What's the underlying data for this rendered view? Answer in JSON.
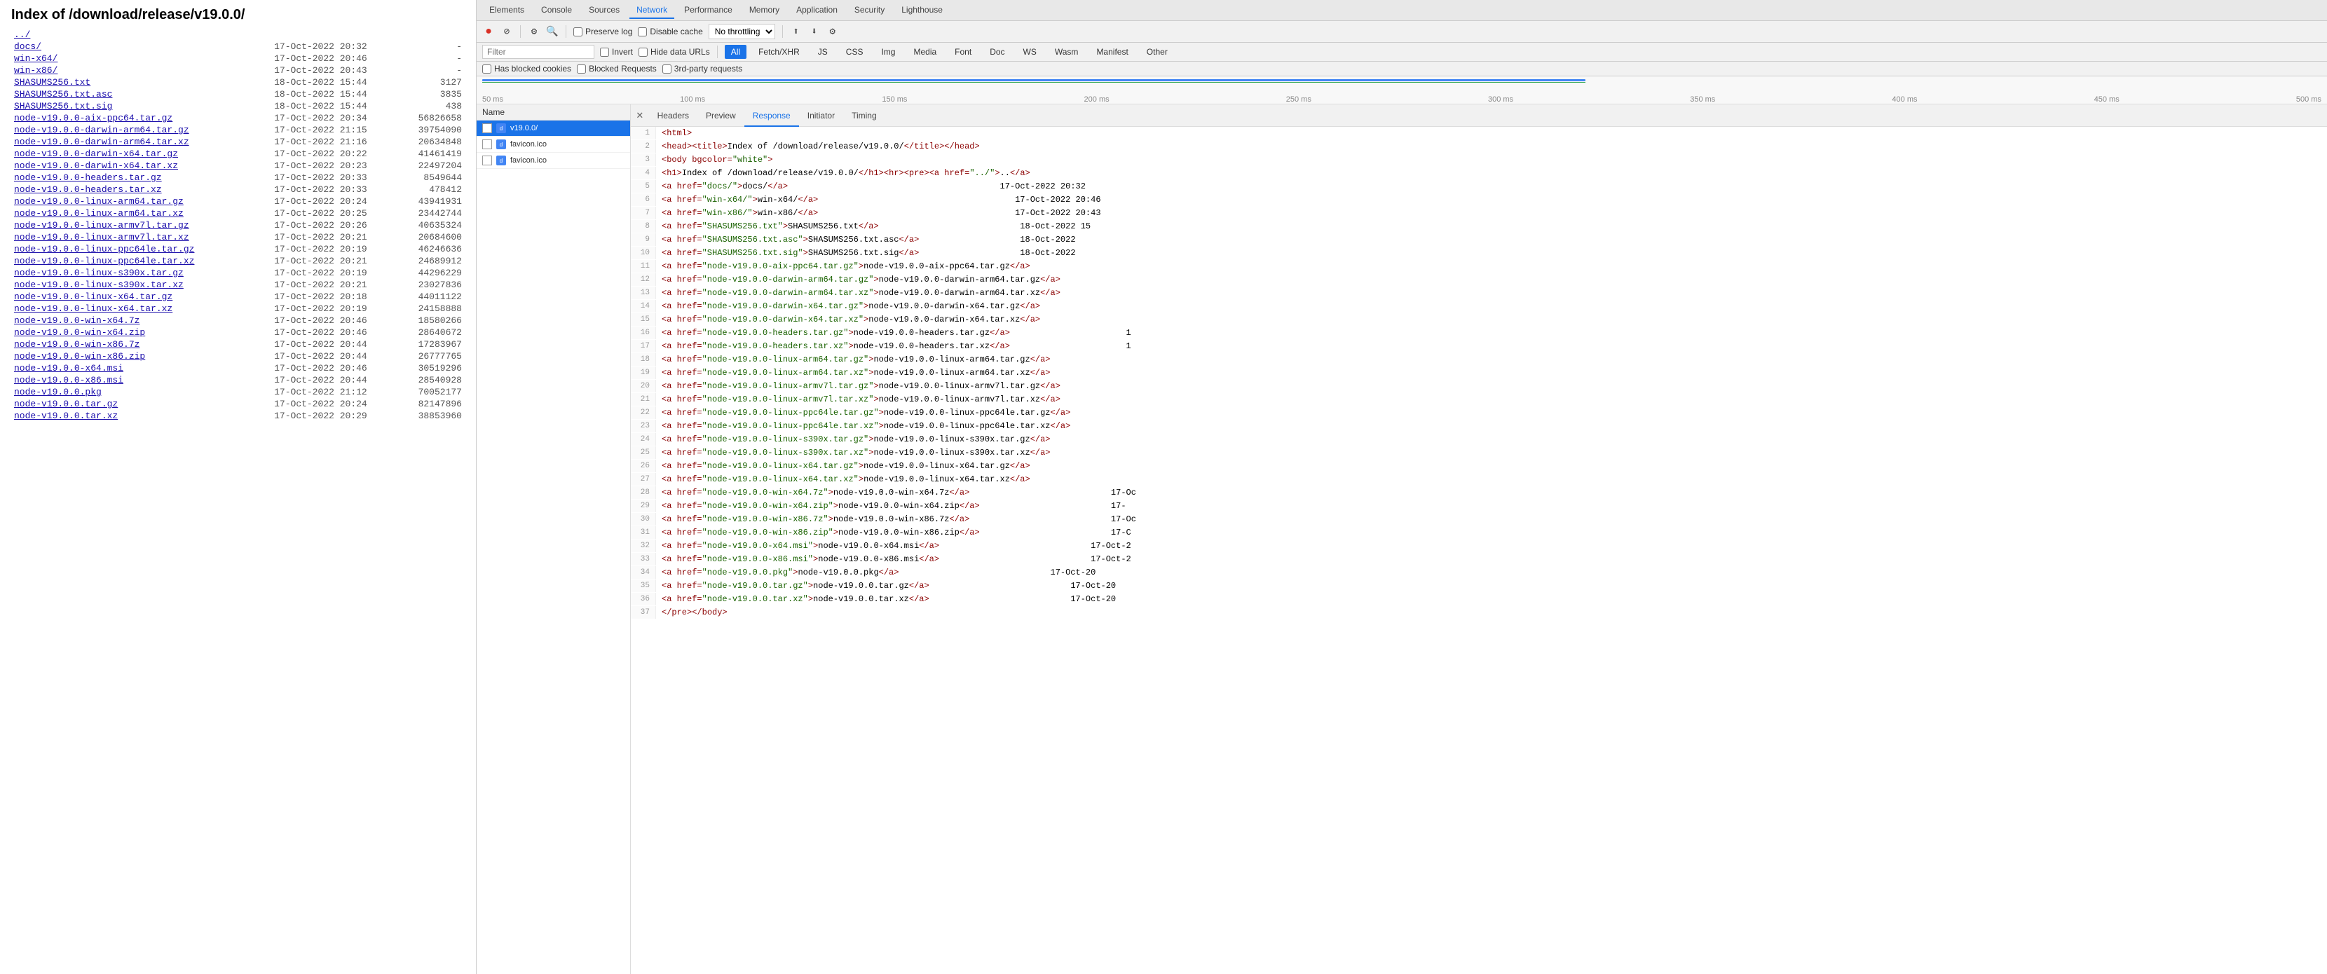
{
  "left": {
    "title": "Index of /download/release/v19.0.0/",
    "parent_link": "../",
    "entries": [
      {
        "name": "docs/",
        "href": "docs/",
        "date": "17-Oct-2022 20:32",
        "size": "-"
      },
      {
        "name": "win-x64/",
        "href": "win-x64/",
        "date": "17-Oct-2022 20:46",
        "size": "-"
      },
      {
        "name": "win-x86/",
        "href": "win-x86/",
        "date": "17-Oct-2022 20:43",
        "size": "-"
      },
      {
        "name": "SHASUMS256.txt",
        "href": "SHASUMS256.txt",
        "date": "18-Oct-2022 15:44",
        "size": "3127"
      },
      {
        "name": "SHASUMS256.txt.asc",
        "href": "SHASUMS256.txt.asc",
        "date": "18-Oct-2022 15:44",
        "size": "3835"
      },
      {
        "name": "SHASUMS256.txt.sig",
        "href": "SHASUMS256.txt.sig",
        "date": "18-Oct-2022 15:44",
        "size": "438"
      },
      {
        "name": "node-v19.0.0-aix-ppc64.tar.gz",
        "href": "node-v19.0.0-aix-ppc64.tar.gz",
        "date": "17-Oct-2022 20:34",
        "size": "56826658"
      },
      {
        "name": "node-v19.0.0-darwin-arm64.tar.gz",
        "href": "node-v19.0.0-darwin-arm64.tar.gz",
        "date": "17-Oct-2022 21:15",
        "size": "39754090"
      },
      {
        "name": "node-v19.0.0-darwin-arm64.tar.xz",
        "href": "node-v19.0.0-darwin-arm64.tar.xz",
        "date": "17-Oct-2022 21:16",
        "size": "20634848"
      },
      {
        "name": "node-v19.0.0-darwin-x64.tar.gz",
        "href": "node-v19.0.0-darwin-x64.tar.gz",
        "date": "17-Oct-2022 20:22",
        "size": "41461419"
      },
      {
        "name": "node-v19.0.0-darwin-x64.tar.xz",
        "href": "node-v19.0.0-darwin-x64.tar.xz",
        "date": "17-Oct-2022 20:23",
        "size": "22497204"
      },
      {
        "name": "node-v19.0.0-headers.tar.gz",
        "href": "node-v19.0.0-headers.tar.gz",
        "date": "17-Oct-2022 20:33",
        "size": "8549644"
      },
      {
        "name": "node-v19.0.0-headers.tar.xz",
        "href": "node-v19.0.0-headers.tar.xz",
        "date": "17-Oct-2022 20:33",
        "size": "478412"
      },
      {
        "name": "node-v19.0.0-linux-arm64.tar.gz",
        "href": "node-v19.0.0-linux-arm64.tar.gz",
        "date": "17-Oct-2022 20:24",
        "size": "43941931"
      },
      {
        "name": "node-v19.0.0-linux-arm64.tar.xz",
        "href": "node-v19.0.0-linux-arm64.tar.xz",
        "date": "17-Oct-2022 20:25",
        "size": "23442744"
      },
      {
        "name": "node-v19.0.0-linux-armv7l.tar.gz",
        "href": "node-v19.0.0-linux-armv7l.tar.gz",
        "date": "17-Oct-2022 20:26",
        "size": "40635324"
      },
      {
        "name": "node-v19.0.0-linux-armv7l.tar.xz",
        "href": "node-v19.0.0-linux-armv7l.tar.xz",
        "date": "17-Oct-2022 20:21",
        "size": "20684600"
      },
      {
        "name": "node-v19.0.0-linux-ppc64le.tar.gz",
        "href": "node-v19.0.0-linux-ppc64le.tar.gz",
        "date": "17-Oct-2022 20:19",
        "size": "46246636"
      },
      {
        "name": "node-v19.0.0-linux-ppc64le.tar.xz",
        "href": "node-v19.0.0-linux-ppc64le.tar.xz",
        "date": "17-Oct-2022 20:21",
        "size": "24689912"
      },
      {
        "name": "node-v19.0.0-linux-s390x.tar.gz",
        "href": "node-v19.0.0-linux-s390x.tar.gz",
        "date": "17-Oct-2022 20:19",
        "size": "44296229"
      },
      {
        "name": "node-v19.0.0-linux-s390x.tar.xz",
        "href": "node-v19.0.0-linux-s390x.tar.xz",
        "date": "17-Oct-2022 20:21",
        "size": "23027836"
      },
      {
        "name": "node-v19.0.0-linux-x64.tar.gz",
        "href": "node-v19.0.0-linux-x64.tar.gz",
        "date": "17-Oct-2022 20:18",
        "size": "44011122"
      },
      {
        "name": "node-v19.0.0-linux-x64.tar.xz",
        "href": "node-v19.0.0-linux-x64.tar.xz",
        "date": "17-Oct-2022 20:19",
        "size": "24158888"
      },
      {
        "name": "node-v19.0.0-win-x64.7z",
        "href": "node-v19.0.0-win-x64.7z",
        "date": "17-Oct-2022 20:46",
        "size": "18580266"
      },
      {
        "name": "node-v19.0.0-win-x64.zip",
        "href": "node-v19.0.0-win-x64.zip",
        "date": "17-Oct-2022 20:46",
        "size": "28640672"
      },
      {
        "name": "node-v19.0.0-win-x86.7z",
        "href": "node-v19.0.0-win-x86.7z",
        "date": "17-Oct-2022 20:44",
        "size": "17283967"
      },
      {
        "name": "node-v19.0.0-win-x86.zip",
        "href": "node-v19.0.0-win-x86.zip",
        "date": "17-Oct-2022 20:44",
        "size": "26777765"
      },
      {
        "name": "node-v19.0.0-x64.msi",
        "href": "node-v19.0.0-x64.msi",
        "date": "17-Oct-2022 20:46",
        "size": "30519296"
      },
      {
        "name": "node-v19.0.0-x86.msi",
        "href": "node-v19.0.0-x86.msi",
        "date": "17-Oct-2022 20:44",
        "size": "28540928"
      },
      {
        "name": "node-v19.0.0.pkg",
        "href": "node-v19.0.0.pkg",
        "date": "17-Oct-2022 21:12",
        "size": "70052177"
      },
      {
        "name": "node-v19.0.0.tar.gz",
        "href": "node-v19.0.0.tar.gz",
        "date": "17-Oct-2022 20:24",
        "size": "82147896"
      },
      {
        "name": "node-v19.0.0.tar.xz",
        "href": "node-v19.0.0.tar.xz",
        "date": "17-Oct-2022 20:29",
        "size": "38853960"
      }
    ]
  },
  "devtools": {
    "top_tabs": [
      "Elements",
      "Console",
      "Sources",
      "Network",
      "Performance",
      "Memory",
      "Application",
      "Security",
      "Lighthouse"
    ],
    "active_top_tab": "Network",
    "toolbar": {
      "record_label": "●",
      "stop_label": "⊘",
      "clear_label": "🚫",
      "filter_label": "⚙",
      "search_label": "🔍",
      "preserve_log_label": "Preserve log",
      "disable_cache_label": "Disable cache",
      "throttling_label": "No throttling",
      "upload_label": "⬆",
      "download_label": "⬇",
      "settings_label": "⚙"
    },
    "filter_row": {
      "invert_label": "Invert",
      "hide_data_urls_label": "Hide data URLs",
      "all_label": "All",
      "fetch_xhr_label": "Fetch/XHR",
      "js_label": "JS",
      "css_label": "CSS",
      "img_label": "Img",
      "media_label": "Media",
      "font_label": "Font",
      "doc_label": "Doc",
      "ws_label": "WS",
      "wasm_label": "Wasm",
      "manifest_label": "Manifest",
      "other_label": "Other",
      "has_blocked_cookies_label": "Has blocked cookies",
      "blocked_requests_label": "Blocked Requests",
      "third_party_label": "3rd-party requests"
    },
    "timeline": {
      "labels": [
        "50 ms",
        "100 ms",
        "150 ms",
        "200 ms",
        "250 ms",
        "300 ms",
        "350 ms",
        "400 ms",
        "450 ms",
        "500 ms"
      ]
    },
    "request_list": {
      "header_name": "Name",
      "requests": [
        {
          "id": "req1",
          "name": "v19.0.0/",
          "selected": true,
          "has_checkbox": true
        },
        {
          "id": "req2",
          "name": "favicon.ico",
          "selected": false,
          "has_checkbox": true
        },
        {
          "id": "req3",
          "name": "favicon.ico",
          "selected": false,
          "has_checkbox": true
        }
      ]
    },
    "details": {
      "tabs": [
        "Headers",
        "Preview",
        "Response",
        "Initiator",
        "Timing"
      ],
      "active_tab": "Response",
      "response_lines": [
        {
          "num": 1,
          "content": "<html>"
        },
        {
          "num": 2,
          "content": "<head><title>Index of /download/release/v19.0.0/</title></head>"
        },
        {
          "num": 3,
          "content": "<body bgcolor=\"white\">"
        },
        {
          "num": 4,
          "content": "<h1>Index of /download/release/v19.0.0/</h1><hr><pre><a href=\"../\">..</a>"
        },
        {
          "num": 5,
          "content": "<a href=\"docs/\">docs/</a>                                          17-Oct-2022 20:32"
        },
        {
          "num": 6,
          "content": "<a href=\"win-x64/\">win-x64/</a>                                       17-Oct-2022 20:46"
        },
        {
          "num": 7,
          "content": "<a href=\"win-x86/\">win-x86/</a>                                       17-Oct-2022 20:43"
        },
        {
          "num": 8,
          "content": "<a href=\"SHASUMS256.txt\">SHASUMS256.txt</a>                            18-Oct-2022 15"
        },
        {
          "num": 9,
          "content": "<a href=\"SHASUMS256.txt.asc\">SHASUMS256.txt.asc</a>                    18-Oct-2022"
        },
        {
          "num": 10,
          "content": "<a href=\"SHASUMS256.txt.sig\">SHASUMS256.txt.sig</a>                    18-Oct-2022"
        },
        {
          "num": 11,
          "content": "<a href=\"node-v19.0.0-aix-ppc64.tar.gz\">node-v19.0.0-aix-ppc64.tar.gz</a>"
        },
        {
          "num": 12,
          "content": "<a href=\"node-v19.0.0-darwin-arm64.tar.gz\">node-v19.0.0-darwin-arm64.tar.gz</a>"
        },
        {
          "num": 13,
          "content": "<a href=\"node-v19.0.0-darwin-arm64.tar.xz\">node-v19.0.0-darwin-arm64.tar.xz</a>"
        },
        {
          "num": 14,
          "content": "<a href=\"node-v19.0.0-darwin-x64.tar.gz\">node-v19.0.0-darwin-x64.tar.gz</a>"
        },
        {
          "num": 15,
          "content": "<a href=\"node-v19.0.0-darwin-x64.tar.xz\">node-v19.0.0-darwin-x64.tar.xz</a>"
        },
        {
          "num": 16,
          "content": "<a href=\"node-v19.0.0-headers.tar.gz\">node-v19.0.0-headers.tar.gz</a>                       1"
        },
        {
          "num": 17,
          "content": "<a href=\"node-v19.0.0-headers.tar.xz\">node-v19.0.0-headers.tar.xz</a>                       1"
        },
        {
          "num": 18,
          "content": "<a href=\"node-v19.0.0-linux-arm64.tar.gz\">node-v19.0.0-linux-arm64.tar.gz</a>"
        },
        {
          "num": 19,
          "content": "<a href=\"node-v19.0.0-linux-arm64.tar.xz\">node-v19.0.0-linux-arm64.tar.xz</a>"
        },
        {
          "num": 20,
          "content": "<a href=\"node-v19.0.0-linux-armv7l.tar.gz\">node-v19.0.0-linux-armv7l.tar.gz</a>"
        },
        {
          "num": 21,
          "content": "<a href=\"node-v19.0.0-linux-armv7l.tar.xz\">node-v19.0.0-linux-armv7l.tar.xz</a>"
        },
        {
          "num": 22,
          "content": "<a href=\"node-v19.0.0-linux-ppc64le.tar.gz\">node-v19.0.0-linux-ppc64le.tar.gz</a>"
        },
        {
          "num": 23,
          "content": "<a href=\"node-v19.0.0-linux-ppc64le.tar.xz\">node-v19.0.0-linux-ppc64le.tar.xz</a>"
        },
        {
          "num": 24,
          "content": "<a href=\"node-v19.0.0-linux-s390x.tar.gz\">node-v19.0.0-linux-s390x.tar.gz</a>"
        },
        {
          "num": 25,
          "content": "<a href=\"node-v19.0.0-linux-s390x.tar.xz\">node-v19.0.0-linux-s390x.tar.xz</a>"
        },
        {
          "num": 26,
          "content": "<a href=\"node-v19.0.0-linux-x64.tar.gz\">node-v19.0.0-linux-x64.tar.gz</a>"
        },
        {
          "num": 27,
          "content": "<a href=\"node-v19.0.0-linux-x64.tar.xz\">node-v19.0.0-linux-x64.tar.xz</a>"
        },
        {
          "num": 28,
          "content": "<a href=\"node-v19.0.0-win-x64.7z\">node-v19.0.0-win-x64.7z</a>                            17-Oc"
        },
        {
          "num": 29,
          "content": "<a href=\"node-v19.0.0-win-x64.zip\">node-v19.0.0-win-x64.zip</a>                          17-"
        },
        {
          "num": 30,
          "content": "<a href=\"node-v19.0.0-win-x86.7z\">node-v19.0.0-win-x86.7z</a>                            17-Oc"
        },
        {
          "num": 31,
          "content": "<a href=\"node-v19.0.0-win-x86.zip\">node-v19.0.0-win-x86.zip</a>                          17-C"
        },
        {
          "num": 32,
          "content": "<a href=\"node-v19.0.0-x64.msi\">node-v19.0.0-x64.msi</a>                              17-Oct-2"
        },
        {
          "num": 33,
          "content": "<a href=\"node-v19.0.0-x86.msi\">node-v19.0.0-x86.msi</a>                              17-Oct-2"
        },
        {
          "num": 34,
          "content": "<a href=\"node-v19.0.0.pkg\">node-v19.0.0.pkg</a>                              17-Oct-20"
        },
        {
          "num": 35,
          "content": "<a href=\"node-v19.0.0.tar.gz\">node-v19.0.0.tar.gz</a>                            17-Oct-20"
        },
        {
          "num": 36,
          "content": "<a href=\"node-v19.0.0.tar.xz\">node-v19.0.0.tar.xz</a>                            17-Oct-20"
        },
        {
          "num": 37,
          "content": "</pre></body>"
        }
      ]
    }
  }
}
